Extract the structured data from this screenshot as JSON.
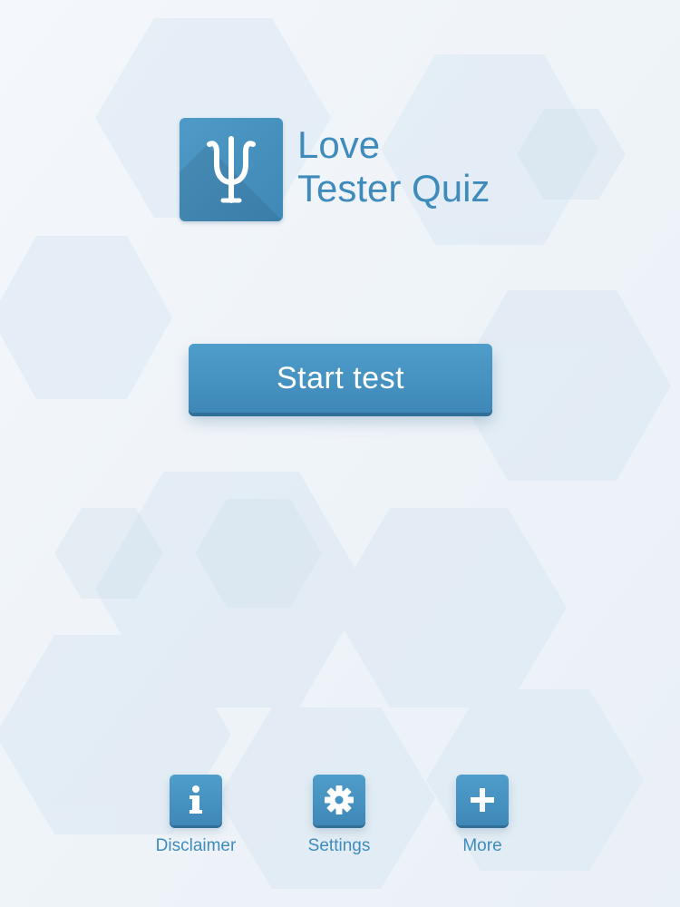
{
  "app": {
    "title_line1": "Love",
    "title_line2": "Tester Quiz",
    "logo_icon": "psi-icon"
  },
  "main": {
    "start_button_label": "Start test"
  },
  "bottom_nav": {
    "items": [
      {
        "label": "Disclaimer",
        "icon": "info-icon"
      },
      {
        "label": "Settings",
        "icon": "gear-icon"
      },
      {
        "label": "More",
        "icon": "plus-icon"
      }
    ]
  },
  "colors": {
    "accent": "#4292c2",
    "accent_dark": "#2f6f98",
    "background": "#eef3f8",
    "button_text": "#ffffff"
  }
}
